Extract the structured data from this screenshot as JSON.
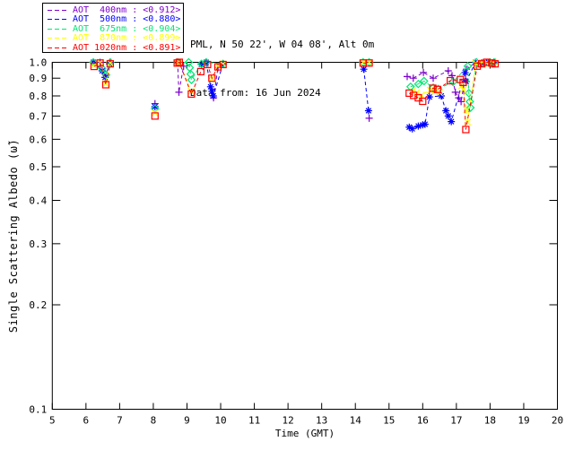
{
  "header": {
    "line1": "PML, N 50 22', W 04 08', Alt 0m",
    "line2": "Data from: 16 Jun 2024"
  },
  "colors": {
    "axis": "#000000",
    "background": "#ffffff"
  },
  "chart_data": {
    "type": "line",
    "title": "",
    "xlabel": "Time (GMT)",
    "ylabel": "Single Scattering Albedo (ω̃)",
    "xlim": [
      5,
      20
    ],
    "ylim": [
      0.1,
      1.0
    ],
    "yscale": "log",
    "grid": false,
    "legend_position": "top-left-outside",
    "x_ticks": [
      {
        "value": 5,
        "label": "5"
      },
      {
        "value": 6,
        "label": "6"
      },
      {
        "value": 7,
        "label": "7"
      },
      {
        "value": 8,
        "label": "8"
      },
      {
        "value": 9,
        "label": "9"
      },
      {
        "value": 10,
        "label": "10"
      },
      {
        "value": 11,
        "label": "11"
      },
      {
        "value": 12,
        "label": "12"
      },
      {
        "value": 13,
        "label": "13"
      },
      {
        "value": 14,
        "label": "14"
      },
      {
        "value": 15,
        "label": "15"
      },
      {
        "value": 16,
        "label": "16"
      },
      {
        "value": 17,
        "label": "17"
      },
      {
        "value": 18,
        "label": "18"
      },
      {
        "value": 19,
        "label": "19"
      },
      {
        "value": 20,
        "label": "20"
      }
    ],
    "y_ticks": [
      {
        "value": 0.1,
        "label": "0.1"
      },
      {
        "value": 0.2,
        "label": "0.2"
      },
      {
        "value": 0.3,
        "label": "0.3"
      },
      {
        "value": 0.4,
        "label": "0.4"
      },
      {
        "value": 0.5,
        "label": "0.5"
      },
      {
        "value": 0.6,
        "label": "0.6"
      },
      {
        "value": 0.7,
        "label": "0.7"
      },
      {
        "value": 0.8,
        "label": "0.8"
      },
      {
        "value": 0.9,
        "label": "0.9"
      },
      {
        "value": 1.0,
        "label": "1.0"
      }
    ],
    "series": [
      {
        "name": "AOT 400nm",
        "mean": "<0.912>",
        "legend_label": "AOT  400nm : <0.912>",
        "color": "#7d00cc",
        "marker": "plus",
        "points": [
          [
            6.42,
            1.0
          ],
          [
            6.57,
            0.905
          ],
          [
            6.72,
            1.0
          ],
          [
            8.05,
            0.76
          ],
          [
            8.72,
            1.0
          ],
          [
            8.76,
            0.82
          ],
          [
            8.9,
            0.975
          ],
          [
            9.79,
            0.79
          ],
          [
            9.92,
            0.965
          ],
          [
            14.41,
            0.69
          ],
          [
            15.54,
            0.91
          ],
          [
            15.72,
            0.9
          ],
          [
            16.02,
            0.935
          ],
          [
            16.31,
            0.9
          ],
          [
            16.76,
            0.945
          ],
          [
            16.87,
            0.915
          ],
          [
            16.97,
            0.82
          ],
          [
            17.07,
            0.79
          ],
          [
            17.14,
            0.77
          ],
          [
            17.3,
            0.955
          ],
          [
            17.57,
            1.0
          ],
          [
            17.72,
            0.99
          ],
          [
            17.9,
            1.0
          ],
          [
            18.05,
            0.99
          ],
          [
            18.15,
            1.0
          ]
        ]
      },
      {
        "name": "AOT 500nm",
        "mean": "<0.880>",
        "legend_label": "AOT  500nm : <0.880>",
        "color": "#0000ff",
        "marker": "asterisk",
        "points": [
          [
            6.22,
            1.0
          ],
          [
            6.48,
            0.945
          ],
          [
            6.57,
            0.905
          ],
          [
            6.7,
            0.99
          ],
          [
            8.05,
            0.745
          ],
          [
            8.72,
            0.995
          ],
          [
            9.43,
            0.985
          ],
          [
            9.57,
            1.0
          ],
          [
            9.7,
            0.85
          ],
          [
            9.74,
            0.825
          ],
          [
            9.78,
            0.8
          ],
          [
            10.07,
            0.99
          ],
          [
            14.25,
            0.955
          ],
          [
            14.39,
            0.725
          ],
          [
            15.6,
            0.65
          ],
          [
            15.69,
            0.643
          ],
          [
            15.87,
            0.655
          ],
          [
            16.0,
            0.66
          ],
          [
            16.07,
            0.663
          ],
          [
            16.2,
            0.795
          ],
          [
            16.55,
            0.8
          ],
          [
            16.69,
            0.725
          ],
          [
            16.76,
            0.7
          ],
          [
            16.85,
            0.675
          ],
          [
            17.26,
            0.935
          ],
          [
            17.29,
            0.88
          ],
          [
            17.57,
            1.0
          ],
          [
            17.75,
            0.995
          ],
          [
            17.95,
            1.0
          ],
          [
            18.1,
            0.995
          ]
        ]
      },
      {
        "name": "AOT 675nm",
        "mean": "<0.904>",
        "legend_label": "AOT  675nm : <0.904>",
        "color": "#00e673",
        "marker": "diamond",
        "points": [
          [
            6.22,
            1.0
          ],
          [
            6.48,
            0.96
          ],
          [
            6.6,
            0.92
          ],
          [
            6.72,
            1.0
          ],
          [
            8.05,
            0.735
          ],
          [
            8.72,
            1.0
          ],
          [
            9.05,
            1.0
          ],
          [
            9.08,
            0.965
          ],
          [
            9.11,
            0.925
          ],
          [
            9.13,
            0.89
          ],
          [
            9.43,
            0.99
          ],
          [
            9.57,
            1.0
          ],
          [
            10.07,
            0.99
          ],
          [
            14.23,
            1.0
          ],
          [
            14.41,
            1.0
          ],
          [
            15.64,
            0.85
          ],
          [
            15.87,
            0.866
          ],
          [
            16.04,
            0.883
          ],
          [
            16.31,
            0.845
          ],
          [
            16.46,
            0.838
          ],
          [
            16.9,
            0.878
          ],
          [
            17.34,
            0.975
          ],
          [
            17.37,
            0.815
          ],
          [
            17.4,
            0.77
          ],
          [
            17.42,
            0.74
          ],
          [
            17.6,
            1.0
          ],
          [
            17.8,
            0.995
          ],
          [
            18.0,
            1.0
          ],
          [
            18.12,
            1.0
          ]
        ]
      },
      {
        "name": "AOT 870nm",
        "mean": "<0.899>",
        "legend_label": "AOT  870nm : <0.899>",
        "color": "#ffff00",
        "marker": "x",
        "points": [
          [
            6.24,
            0.98
          ],
          [
            6.42,
            1.0
          ],
          [
            6.59,
            0.868
          ],
          [
            6.72,
            0.995
          ],
          [
            8.05,
            0.715
          ],
          [
            8.73,
            0.995
          ],
          [
            8.77,
            1.0
          ],
          [
            9.12,
            0.825
          ],
          [
            9.74,
            0.895
          ],
          [
            9.92,
            0.975
          ],
          [
            10.07,
            0.99
          ],
          [
            14.23,
            1.0
          ],
          [
            14.41,
            1.0
          ],
          [
            15.69,
            0.825
          ],
          [
            15.82,
            0.818
          ],
          [
            15.96,
            0.805
          ],
          [
            16.22,
            0.832
          ],
          [
            16.36,
            0.825
          ],
          [
            16.5,
            0.818
          ],
          [
            17.16,
            0.855
          ],
          [
            17.2,
            0.835
          ],
          [
            17.3,
            0.73
          ],
          [
            17.33,
            0.672
          ],
          [
            17.57,
            0.995
          ],
          [
            17.77,
            1.0
          ],
          [
            17.95,
            0.99
          ],
          [
            18.1,
            1.0
          ]
        ]
      },
      {
        "name": "AOT 1020nm",
        "mean": "<0.891>",
        "legend_label": "AOT 1020nm : <0.891>",
        "color": "#ff0000",
        "marker": "square",
        "points": [
          [
            6.24,
            0.973
          ],
          [
            6.42,
            0.995
          ],
          [
            6.59,
            0.862
          ],
          [
            6.72,
            0.99
          ],
          [
            8.05,
            0.7
          ],
          [
            8.71,
            0.995
          ],
          [
            8.77,
            1.0
          ],
          [
            9.13,
            0.81
          ],
          [
            9.41,
            0.94
          ],
          [
            9.61,
            0.985
          ],
          [
            9.74,
            0.9
          ],
          [
            9.92,
            0.97
          ],
          [
            10.07,
            0.985
          ],
          [
            14.23,
            0.995
          ],
          [
            14.41,
            0.995
          ],
          [
            15.6,
            0.815
          ],
          [
            15.73,
            0.803
          ],
          [
            15.87,
            0.79
          ],
          [
            16.0,
            0.772
          ],
          [
            16.3,
            0.842
          ],
          [
            16.44,
            0.835
          ],
          [
            16.82,
            0.885
          ],
          [
            17.12,
            0.892
          ],
          [
            17.2,
            0.875
          ],
          [
            17.28,
            0.64
          ],
          [
            17.62,
            0.975
          ],
          [
            17.75,
            0.99
          ],
          [
            17.9,
            1.0
          ],
          [
            18.05,
            0.995
          ],
          [
            18.15,
            0.99
          ]
        ]
      }
    ]
  }
}
